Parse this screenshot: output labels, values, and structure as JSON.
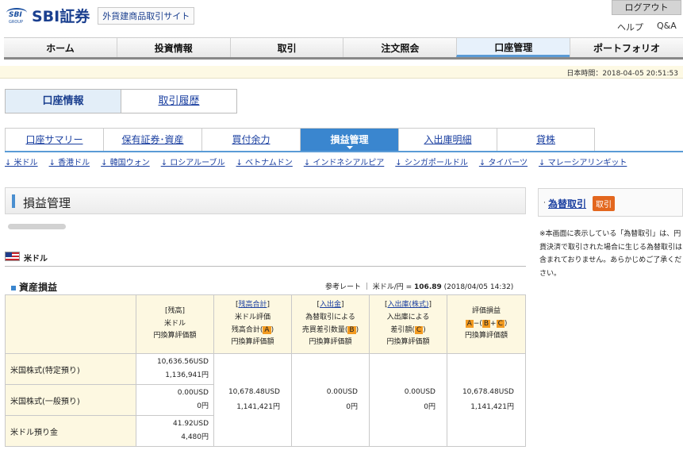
{
  "header": {
    "logo_mark": "SBI",
    "logo_group": "GROUP",
    "brand": "SBI証券",
    "subtitle": "外貨建商品取引サイト",
    "logout": "ログアウト",
    "help": "ヘルプ",
    "qa": "Q&A"
  },
  "gnav": [
    "ホーム",
    "投資情報",
    "取引",
    "注文照会",
    "口座管理",
    "ポートフォリオ"
  ],
  "gnav_active": 4,
  "time": "日本時間：2018-04-05 20:51:53",
  "subtabs": {
    "active": "口座情報",
    "other": "取引履歴"
  },
  "tnav": [
    "口座サマリー",
    "保有証券･資産",
    "買付余力",
    "損益管理",
    "入出庫明細",
    "貸株"
  ],
  "currencies": [
    "↓ 米ドル",
    "↓ 香港ドル",
    "↓ 韓国ウォン",
    "↓ ロシアルーブル",
    "↓ ベトナムドン",
    "↓ インドネシアルピア",
    "↓ シンガポールドル",
    "↓ タイバーツ",
    "↓ マレーシアリンギット"
  ],
  "section_title": "損益管理",
  "currency_label": "米ドル",
  "asset_title": "資産損益",
  "rate": {
    "prefix": "参考レート ｜ 米ドル/円 = ",
    "value": "106.89",
    "time": " (2018/04/05 14:32)"
  },
  "table": {
    "h1": {
      "l1": "[残高]",
      "l2": "米ドル",
      "l3": "円換算評価額"
    },
    "h2": {
      "link": "残高合計",
      "l2": "米ドル評価",
      "l3a": "残高合計",
      "tag": "A",
      "l4": "円換算評価額"
    },
    "h3": {
      "link": "入出金",
      "l2": "為替取引による",
      "l3a": "売買差引数量",
      "tag": "B",
      "l4": "円換算評価額"
    },
    "h4": {
      "link": "入出庫(株式)",
      "l2": "入出庫による",
      "l3a": "差引額",
      "tag": "C",
      "l4": "円換算評価額"
    },
    "h5": {
      "l1": "評価損益",
      "a": "A",
      "b": "B",
      "c": "C",
      "l3": "円換算評価額"
    },
    "rows": [
      {
        "label": "米国株式(特定預り)",
        "usd": "10,636.56USD",
        "jpy": "1,136,941円"
      },
      {
        "label": "米国株式(一般預り)",
        "usd": "0.00USD",
        "jpy": "0円"
      },
      {
        "label": "米ドル預り金",
        "usd": "41.92USD",
        "jpy": "4,480円"
      }
    ],
    "total": {
      "usd": "10,678.48USD",
      "jpy": "1,141,421円"
    },
    "fx": {
      "usd": "0.00USD",
      "jpy": "0円"
    },
    "io": {
      "usd": "0.00USD",
      "jpy": "0円"
    },
    "pl": {
      "usd": "10,678.48USD",
      "jpy": "1,141,421円"
    }
  },
  "fx_panel": {
    "link": "為替取引",
    "button": "取引"
  },
  "note": "※本画面に表示している「為替取引」は、円貨決済で取引された場合に生じる為替取引は含まれておりません。あらかじめご了承ください。"
}
